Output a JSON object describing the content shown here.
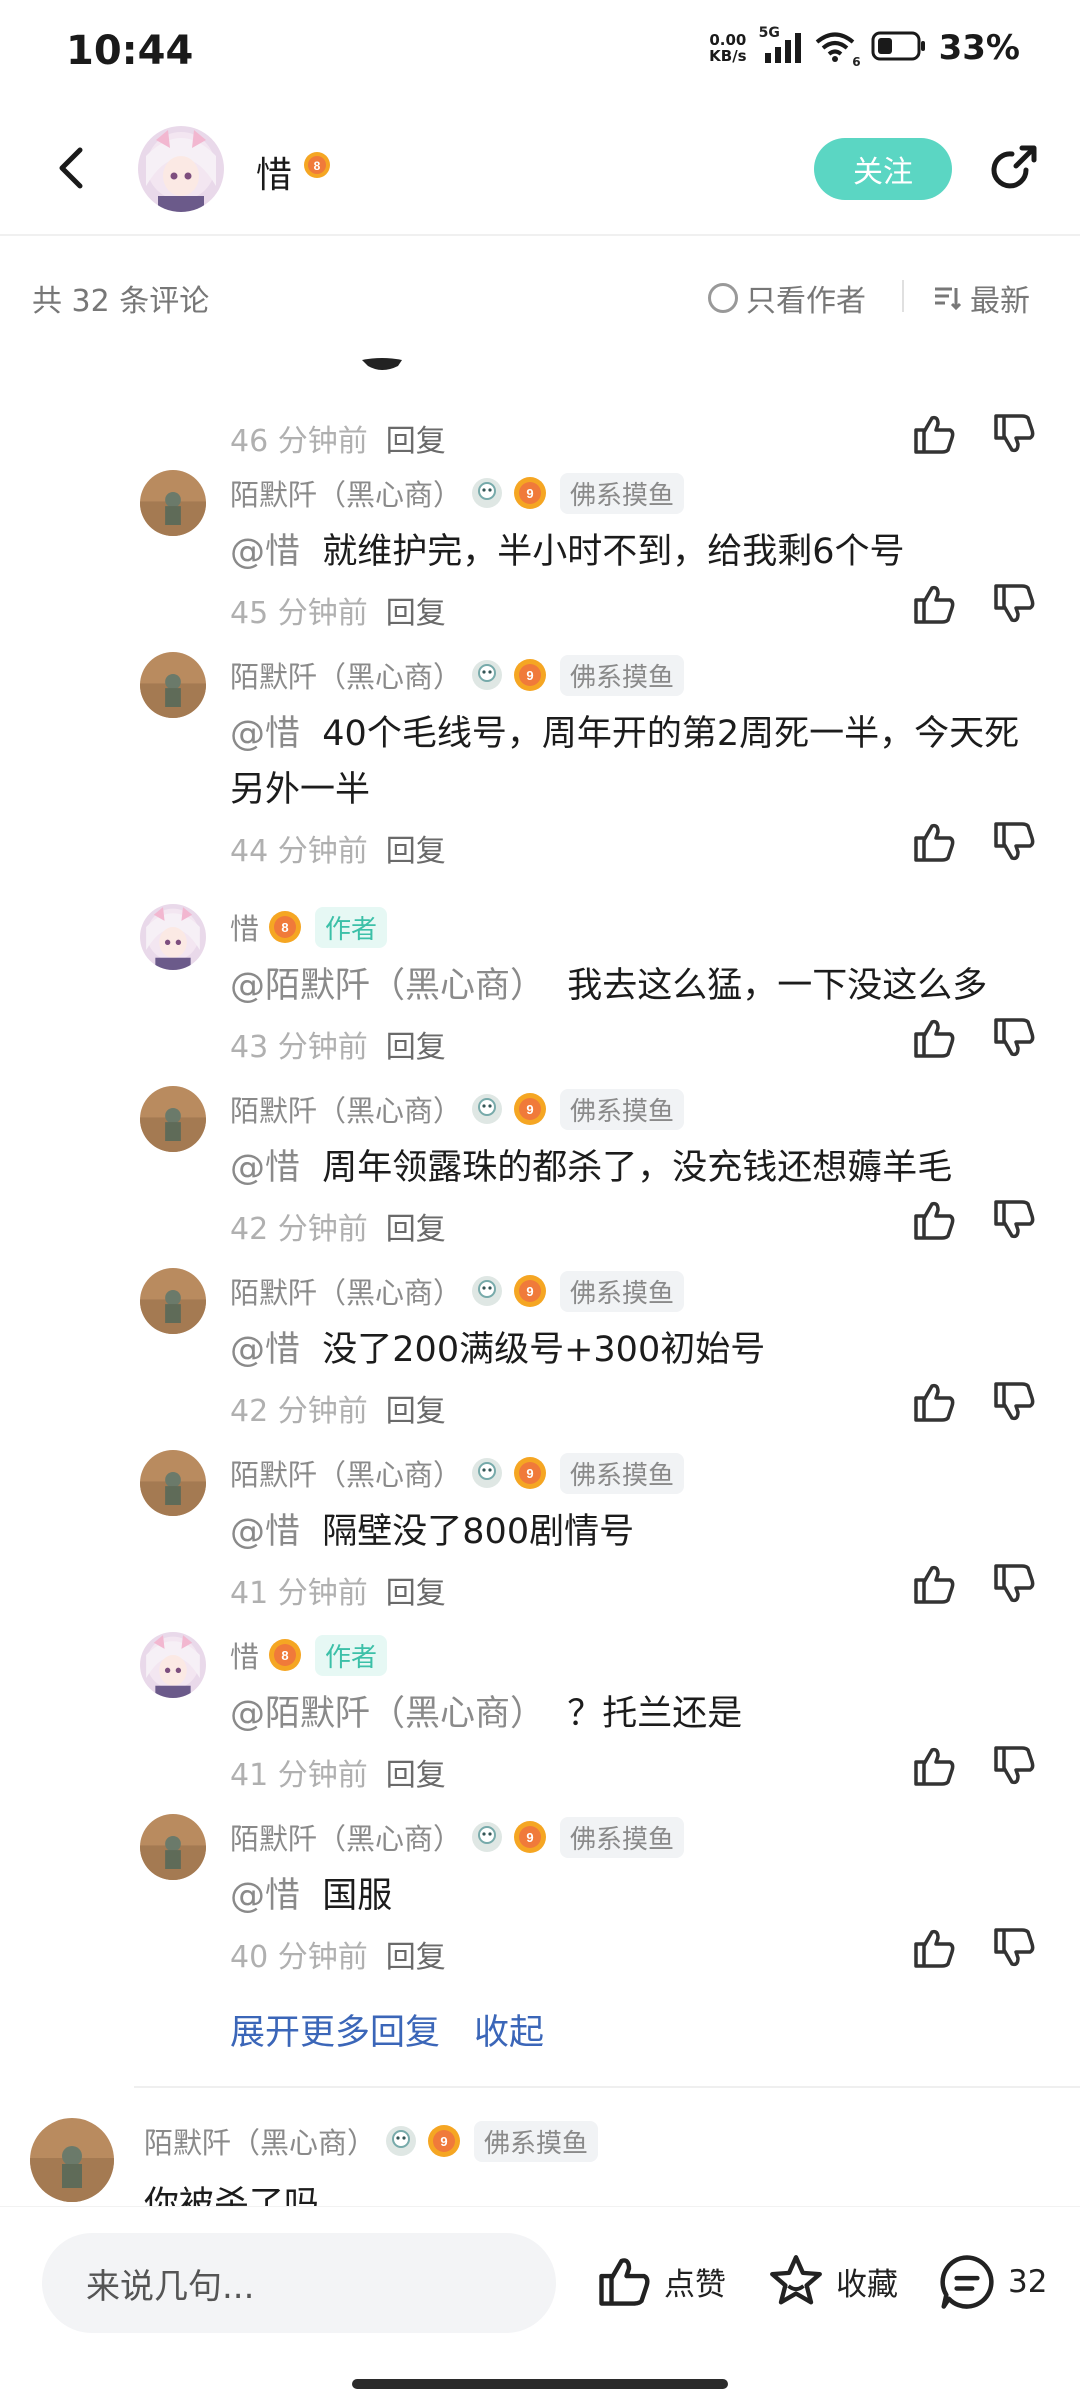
{
  "status_bar": {
    "time": "10:44",
    "net_speed_value": "0.00",
    "net_speed_unit": "KB/s",
    "network_type": "5G",
    "wifi_badge": "6",
    "battery": "33%"
  },
  "header": {
    "author_name": "惜",
    "author_level": "8",
    "follow_label": "关注"
  },
  "comments_bar": {
    "count_text": "共 32 条评论",
    "only_author_label": "只看作者",
    "sort_label": "最新"
  },
  "first_meta": {
    "time": "46 分钟前",
    "reply_label": "回复"
  },
  "replies": [
    {
      "name": "陌默阡（黑心商）",
      "level": "9",
      "tag": "佛系摸鱼",
      "is_author": false,
      "at": "@惜",
      "text": "就维护完，半小时不到，给我剩6个号",
      "time": "45 分钟前",
      "reply_label": "回复"
    },
    {
      "name": "陌默阡（黑心商）",
      "level": "9",
      "tag": "佛系摸鱼",
      "is_author": false,
      "at": "@惜",
      "text": "40个毛线号，周年开的第2周死一半，今天死另外一半",
      "time": "44 分钟前",
      "reply_label": "回复"
    },
    {
      "name": "惜",
      "level": "8",
      "tag": "作者",
      "is_author": true,
      "at": "@陌默阡（黑心商）",
      "text": "我去这么猛，一下没这么多",
      "time": "43 分钟前",
      "reply_label": "回复"
    },
    {
      "name": "陌默阡（黑心商）",
      "level": "9",
      "tag": "佛系摸鱼",
      "is_author": false,
      "at": "@惜",
      "text": "周年领露珠的都杀了，没充钱还想薅羊毛",
      "time": "42 分钟前",
      "reply_label": "回复"
    },
    {
      "name": "陌默阡（黑心商）",
      "level": "9",
      "tag": "佛系摸鱼",
      "is_author": false,
      "at": "@惜",
      "text": "没了200满级号+300初始号",
      "time": "42 分钟前",
      "reply_label": "回复"
    },
    {
      "name": "陌默阡（黑心商）",
      "level": "9",
      "tag": "佛系摸鱼",
      "is_author": false,
      "at": "@惜",
      "text": "隔壁没了800剧情号",
      "time": "41 分钟前",
      "reply_label": "回复"
    },
    {
      "name": "惜",
      "level": "8",
      "tag": "作者",
      "is_author": true,
      "at": "@陌默阡（黑心商）",
      "text": "？托兰还是",
      "time": "41 分钟前",
      "reply_label": "回复"
    },
    {
      "name": "陌默阡（黑心商）",
      "level": "9",
      "tag": "佛系摸鱼",
      "is_author": false,
      "at": "@惜",
      "text": "国服",
      "time": "40 分钟前",
      "reply_label": "回复"
    }
  ],
  "expand": {
    "more_label": "展开更多回复",
    "collapse_label": "收起"
  },
  "top_comment": {
    "name": "陌默阡（黑心商）",
    "level": "9",
    "tag": "佛系摸鱼",
    "text": "你被杀了吗"
  },
  "bottom_bar": {
    "input_placeholder": "来说几句...",
    "like_label": "点赞",
    "collect_label": "收藏",
    "comment_count": "32"
  },
  "colors": {
    "accent_teal": "#5bd6c3",
    "link_blue": "#3b66b8",
    "level_orange": "#f07a3a"
  }
}
